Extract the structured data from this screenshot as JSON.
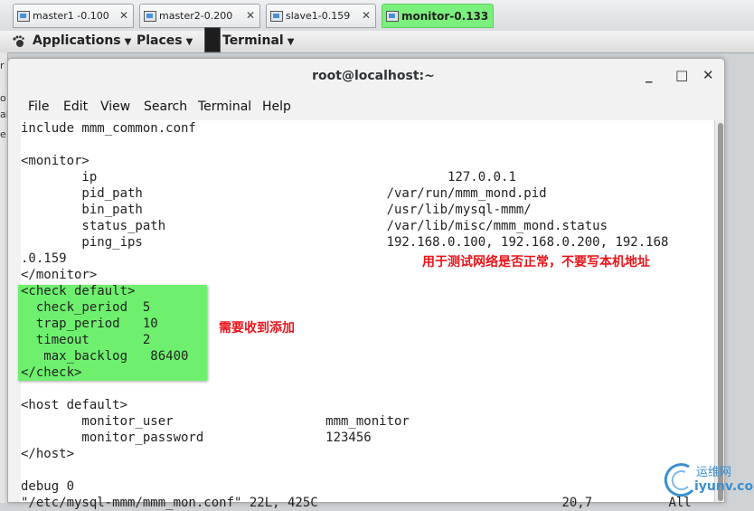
{
  "vm_tabs": [
    {
      "label": "master1 -0.100",
      "active": false
    },
    {
      "label": "master2-0.200",
      "active": false
    },
    {
      "label": "slave1-0.159",
      "active": false
    },
    {
      "label": "monitor-0.133",
      "active": true
    }
  ],
  "panel": {
    "applications": "Applications",
    "places": "Places",
    "terminal": "Terminal"
  },
  "window": {
    "title": "root@localhost:~",
    "minimize": "_",
    "maximize": "□",
    "close": "✕"
  },
  "menu": [
    "File",
    "Edit",
    "View",
    "Search",
    "Terminal",
    "Help"
  ],
  "terminal_lines": [
    "include mmm_common.conf",
    "",
    "<monitor>",
    "        ip                                              127.0.0.1",
    "        pid_path                                /var/run/mmm_mond.pid",
    "        bin_path                                /usr/lib/mysql-mmm/",
    "        status_path                             /var/lib/misc/mmm_mond.status",
    "        ping_ips                                192.168.0.100, 192.168.0.200, 192.168",
    ".0.159",
    "</monitor>",
    "<check default>",
    "  check_period  5",
    "  trap_period   10",
    "  timeout       2",
    "   max_backlog   86400",
    "</check>",
    "",
    "<host default>",
    "        monitor_user                    mmm_monitor",
    "        monitor_password                123456",
    "</host>",
    "",
    "debug 0",
    "\"/etc/mysql-mmm/mmm_mon.conf\" 22L, 425C                                20,7          All"
  ],
  "annotations": {
    "ping_note": "用于测试网络是否正常，不要写本机地址",
    "check_note": "需要收到添加"
  },
  "watermark": {
    "top": "运维网",
    "bottom": "iyunv.com"
  },
  "colors": {
    "highlight": "#6ef06e",
    "active_tab": "#7cf07c",
    "annotation": "#e8151b"
  }
}
